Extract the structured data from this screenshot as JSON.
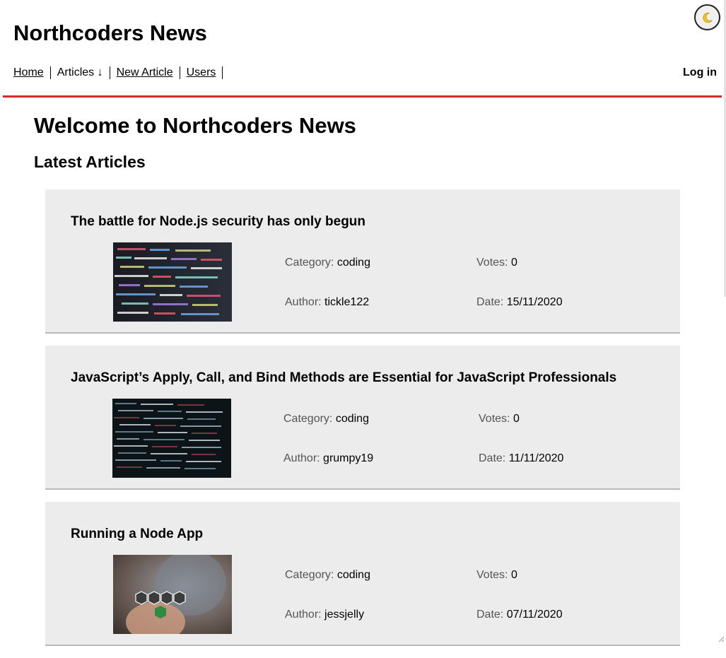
{
  "site": {
    "title": "Northcoders News",
    "theme_toggle_icon": "moon-icon"
  },
  "nav": {
    "items": [
      {
        "label": "Home"
      },
      {
        "label": "Articles ↓"
      },
      {
        "label": "New Article"
      },
      {
        "label": "Users"
      }
    ],
    "login_label": "Log in"
  },
  "main": {
    "welcome": "Welcome to Northcoders News",
    "latest_heading": "Latest Articles"
  },
  "labels": {
    "category": "Category:",
    "author": "Author:",
    "votes": "Votes:",
    "date": "Date:"
  },
  "articles": [
    {
      "title": "The battle for Node.js security has only begun",
      "category": "coding",
      "author": "tickle122",
      "votes": "0",
      "date": "15/11/2020",
      "image": "code-screen-photo"
    },
    {
      "title": "JavaScript’s Apply, Call, and Bind Methods are Essential for JavaScript Professionals",
      "category": "coding",
      "author": "grumpy19",
      "votes": "0",
      "date": "11/11/2020",
      "image": "dark-code-screen-photo"
    },
    {
      "title": "Running a Node App",
      "category": "coding",
      "author": "jessjelly",
      "votes": "0",
      "date": "07/11/2020",
      "image": "node-logo-photo"
    }
  ],
  "colors": {
    "accent": "#d42a2a",
    "card_bg": "#ececec",
    "card_border": "#b9b9b9"
  }
}
